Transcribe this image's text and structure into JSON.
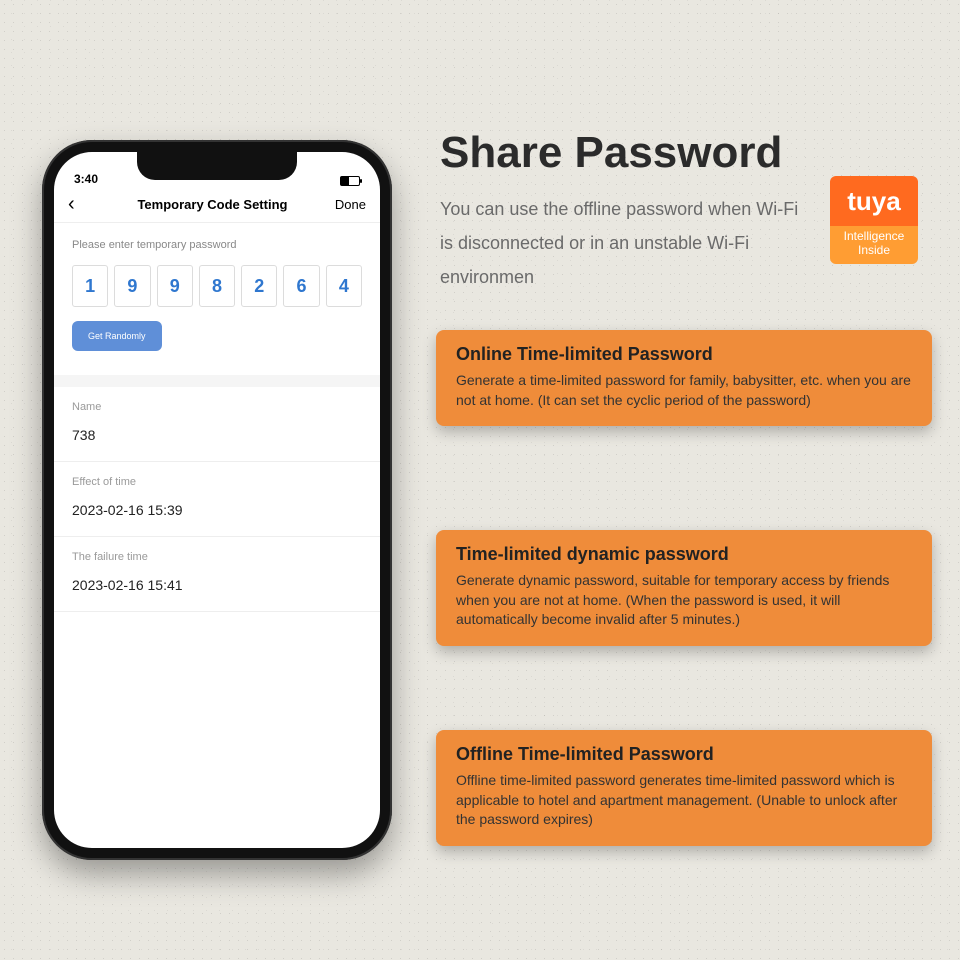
{
  "phone": {
    "status_time": "3:40",
    "nav": {
      "title": "Temporary Code Setting",
      "done": "Done"
    },
    "prompt": "Please enter temporary password",
    "code": [
      "1",
      "9",
      "9",
      "8",
      "2",
      "6",
      "4"
    ],
    "random_btn": "Get Randomly",
    "rows": {
      "name_label": "Name",
      "name_value": "738",
      "effect_label": "Effect of time",
      "effect_value": "2023-02-16 15:39",
      "fail_label": "The failure time",
      "fail_value": "2023-02-16 15:41"
    }
  },
  "headline": {
    "title": "Share Password",
    "desc": "You can use the offline password when Wi-Fi is disconnected or in an unstable Wi-Fi environmen"
  },
  "tuya": {
    "brand": "tuya",
    "line1": "Intelligence",
    "line2": "Inside"
  },
  "cards": [
    {
      "title": "Online Time-limited Password",
      "body": "Generate a time-limited password for family, babysitter, etc. when you are not at home.  (It can set the cyclic period of the password)"
    },
    {
      "title": "Time-limited dynamic password",
      "body": "Generate dynamic password, suitable for temporary access by friends when you are not at home. (When the password is used, it will automatically become invalid after 5 minutes.)"
    },
    {
      "title": "Offline Time-limited Password",
      "body": "Offline time-limited password generates time-limited password which is applicable to hotel and apartment management. (Unable to unlock after the password expires)"
    }
  ]
}
